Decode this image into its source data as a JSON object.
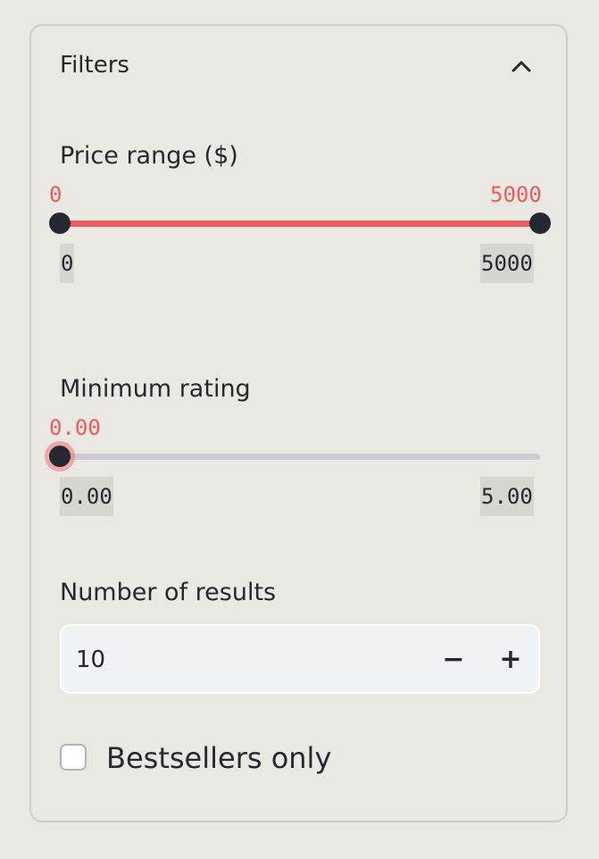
{
  "header": {
    "title": "Filters",
    "toggle_icon": "chevron-up-icon"
  },
  "price_range": {
    "label": "Price range ($)",
    "value_low": "0",
    "value_high": "5000",
    "min_label": "0",
    "max_label": "5000",
    "min": 0,
    "max": 5000,
    "selected": [
      0,
      5000
    ]
  },
  "rating": {
    "label": "Minimum rating",
    "value": "0.00",
    "min_label": "0.00",
    "max_label": "5.00",
    "min": 0,
    "max": 5,
    "selected": 0
  },
  "results": {
    "label": "Number of results",
    "value": "10",
    "decrement": "−",
    "increment": "+"
  },
  "bestsellers": {
    "label": "Bestsellers only",
    "checked": false
  },
  "colors": {
    "accent": "#ee5a59",
    "accent_text": "#f05a5a",
    "thumb": "#262730",
    "track": "#cbcbd1",
    "background": "#eae8e3",
    "input_bg": "#f0f2f6"
  }
}
